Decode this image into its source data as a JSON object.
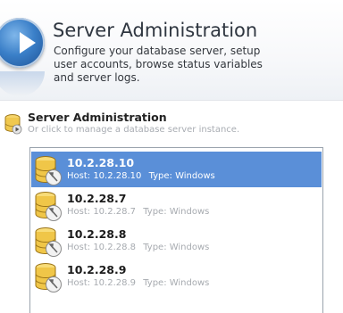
{
  "header": {
    "title": "Server Administration",
    "description": "Configure your database server, setup user accounts, browse status variables and server logs."
  },
  "section": {
    "title": "Server Administration",
    "subtitle": "Or click to manage a database server instance."
  },
  "servers": [
    {
      "ip": "10.2.28.10",
      "host": "Host: 10.2.28.10",
      "type": "Type: Windows",
      "selected": true
    },
    {
      "ip": "10.2.28.7",
      "host": "Host: 10.2.28.7",
      "type": "Type: Windows",
      "selected": false
    },
    {
      "ip": "10.2.28.8",
      "host": "Host: 10.2.28.8",
      "type": "Type: Windows",
      "selected": false
    },
    {
      "ip": "10.2.28.9",
      "host": "Host: 10.2.28.9",
      "type": "Type: Windows",
      "selected": false
    }
  ],
  "icons": {
    "header": "play-circle-icon",
    "section": "database-play-icon",
    "server": "database-wrench-icon"
  },
  "colors": {
    "selection": "#5a8fd8",
    "subtle_text": "#a7abb0"
  }
}
